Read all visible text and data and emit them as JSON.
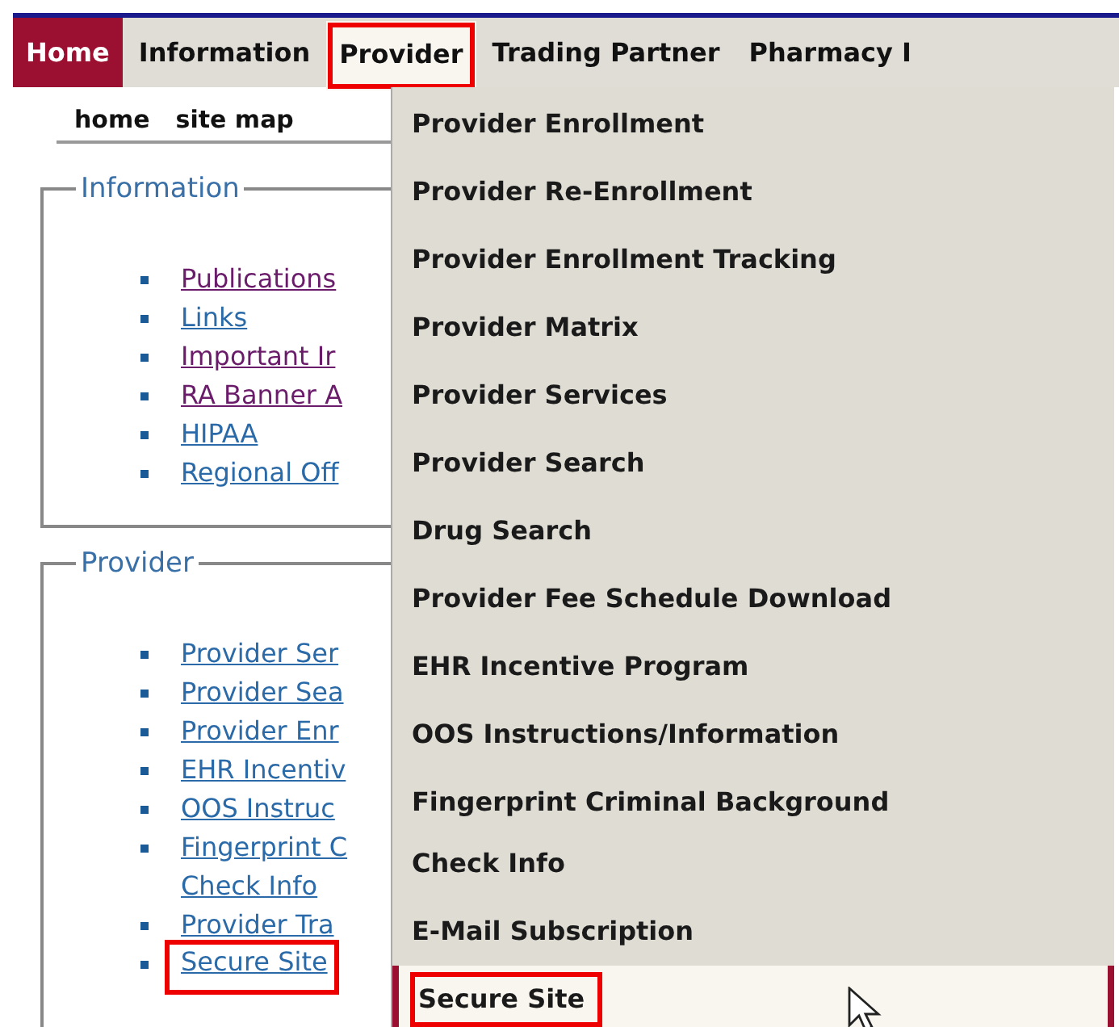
{
  "nav": [
    {
      "label": "Home",
      "selected": true,
      "open": false,
      "highlighted": false
    },
    {
      "label": "Information",
      "selected": false,
      "open": false,
      "highlighted": false
    },
    {
      "label": "Provider",
      "selected": false,
      "open": true,
      "highlighted": true
    },
    {
      "label": "Trading Partner",
      "selected": false,
      "open": false,
      "highlighted": false
    },
    {
      "label": "Pharmacy I",
      "selected": false,
      "open": false,
      "highlighted": false
    }
  ],
  "subnav": [
    "home",
    "site map"
  ],
  "sections": [
    {
      "legend": "Information",
      "links": [
        {
          "lines": [
            "Publications"
          ],
          "visited": true,
          "highlighted": false
        },
        {
          "lines": [
            "Links"
          ],
          "visited": false,
          "highlighted": false
        },
        {
          "lines": [
            "Important Ir"
          ],
          "visited": true,
          "highlighted": false
        },
        {
          "lines": [
            "RA Banner A"
          ],
          "visited": true,
          "highlighted": false
        },
        {
          "lines": [
            "HIPAA"
          ],
          "visited": false,
          "highlighted": false
        },
        {
          "lines": [
            "Regional Off"
          ],
          "visited": false,
          "highlighted": false
        }
      ]
    },
    {
      "legend": "Provider",
      "links": [
        {
          "lines": [
            "Provider Ser"
          ],
          "visited": false,
          "highlighted": false
        },
        {
          "lines": [
            "Provider Sea"
          ],
          "visited": false,
          "highlighted": false
        },
        {
          "lines": [
            "Provider Enr"
          ],
          "visited": false,
          "highlighted": false
        },
        {
          "lines": [
            "EHR Incentiv"
          ],
          "visited": false,
          "highlighted": false
        },
        {
          "lines": [
            "OOS Instruc"
          ],
          "visited": false,
          "highlighted": false
        },
        {
          "lines": [
            "Fingerprint C",
            "Check Info"
          ],
          "visited": false,
          "highlighted": false
        },
        {
          "lines": [
            "Provider Tra"
          ],
          "visited": false,
          "highlighted": false
        },
        {
          "lines": [
            "Secure Site"
          ],
          "visited": false,
          "highlighted": true
        }
      ]
    }
  ],
  "menu": [
    {
      "lines": [
        "Provider Enrollment"
      ],
      "selected": false,
      "highlighted": false
    },
    {
      "lines": [
        "Provider Re-Enrollment"
      ],
      "selected": false,
      "highlighted": false
    },
    {
      "lines": [
        "Provider Enrollment Tracking"
      ],
      "selected": false,
      "highlighted": false
    },
    {
      "lines": [
        "Provider Matrix"
      ],
      "selected": false,
      "highlighted": false
    },
    {
      "lines": [
        "Provider Services"
      ],
      "selected": false,
      "highlighted": false
    },
    {
      "lines": [
        "Provider Search"
      ],
      "selected": false,
      "highlighted": false
    },
    {
      "lines": [
        "Drug Search"
      ],
      "selected": false,
      "highlighted": false
    },
    {
      "lines": [
        "Provider Fee Schedule Download"
      ],
      "selected": false,
      "highlighted": false
    },
    {
      "lines": [
        "EHR Incentive Program"
      ],
      "selected": false,
      "highlighted": false
    },
    {
      "lines": [
        "OOS Instructions/Information"
      ],
      "selected": false,
      "highlighted": false
    },
    {
      "lines": [
        "Fingerprint Criminal Background",
        "Check Info"
      ],
      "selected": false,
      "highlighted": false
    },
    {
      "lines": [
        "E-Mail Subscription"
      ],
      "selected": false,
      "highlighted": false
    },
    {
      "lines": [
        "Secure Site"
      ],
      "selected": true,
      "highlighted": true
    }
  ]
}
